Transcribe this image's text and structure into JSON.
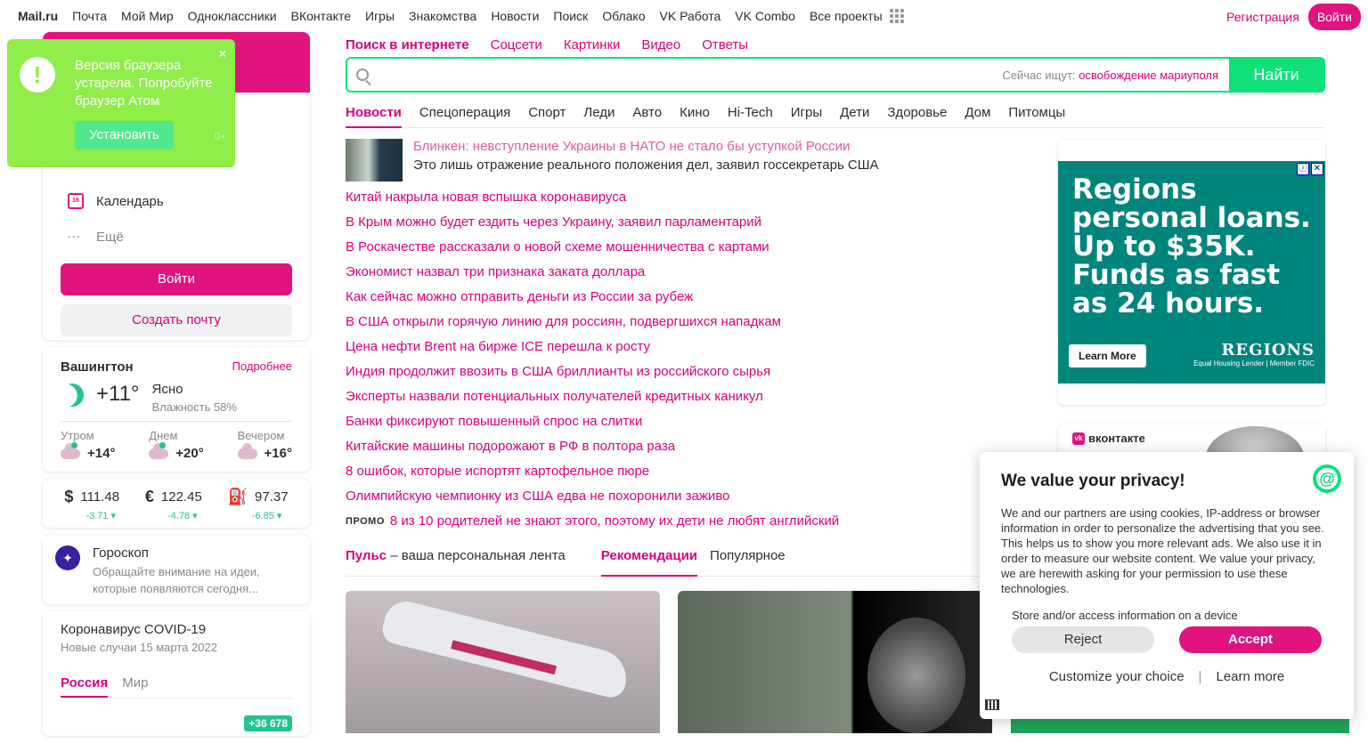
{
  "topbar": {
    "logo": "Mail.ru",
    "items": [
      "Почта",
      "Мой Мир",
      "Одноклассники",
      "ВКонтакте",
      "Игры",
      "Знакомства",
      "Новости",
      "Поиск",
      "Облако",
      "VK Работа",
      "VK Combo",
      "Все проекты"
    ],
    "register": "Регистрация",
    "login": "Войти"
  },
  "browser_popup": {
    "text": "Версия браузера устарела. Попробуйте браузер Атом",
    "button": "Установить",
    "close": "×",
    "counter": "0+"
  },
  "mail_card": {
    "calendar_label": "Календарь",
    "calendar_day": "16",
    "more_label": "Ещё",
    "login_button": "Войти",
    "create_button": "Создать почту"
  },
  "weather": {
    "city": "Вашингтон",
    "more": "Подробнее",
    "temp": "+11°",
    "desc": "Ясно",
    "humidity": "Влажность 58%",
    "parts": [
      {
        "label": "Утром",
        "temp": "+14°"
      },
      {
        "label": "Днем",
        "temp": "+20°"
      },
      {
        "label": "Вечером",
        "temp": "+16°"
      }
    ]
  },
  "rates": [
    {
      "symbol": "$",
      "value": "111.48",
      "change": "-3.71 ▾"
    },
    {
      "symbol": "€",
      "value": "122.45",
      "change": "-4.78 ▾"
    },
    {
      "symbol": "⛽",
      "value": "97.37",
      "change": "-6.85 ▾"
    }
  ],
  "horoscope": {
    "title": "Гороскоп",
    "text": "Обращайте внимание на идеи, которые появляются сегодня...",
    "icon": "✦"
  },
  "covid": {
    "title": "Коронавирус COVID-19",
    "subtitle": "Новые случаи 15 марта 2022",
    "tabs": [
      "Россия",
      "Мир"
    ],
    "badge": "+36 678"
  },
  "search": {
    "tabs": [
      "Поиск в интернете",
      "Соцсети",
      "Картинки",
      "Видео",
      "Ответы"
    ],
    "hint_label": "Сейчас ищут:",
    "hint_query": "освобождение мариуполя",
    "button": "Найти"
  },
  "news_tabs": [
    "Новости",
    "Спецоперация",
    "Спорт",
    "Леди",
    "Авто",
    "Кино",
    "Hi-Tech",
    "Игры",
    "Дети",
    "Здоровье",
    "Дом",
    "Питомцы"
  ],
  "news": {
    "lead_title": "Блинкен: невступление Украины в НАТО не стало бы уступкой России",
    "lead_sub": "Это лишь отражение реального положения дел, заявил госсекретарь США",
    "items": [
      "Китай накрыла новая вспышка коронавируса",
      "В Крым можно будет ездить через Украину, заявил парламентарий",
      "В Роскачестве рассказали о новой схеме мошенничества с картами",
      "Экономист назвал три признака заката доллара",
      "Как сейчас можно отправить деньги из России за рубеж",
      "В США открыли горячую линию для россиян, подвергшихся нападкам",
      "Цена нефти Brent на бирже ICE перешла к росту",
      "Индия продолжит ввозить в США бриллианты из российского сырья",
      "Эксперты назвали потенциальных получателей кредитных каникул",
      "Банки фиксируют повышенный спрос на слитки",
      "Китайские машины подорожают в РФ в полтора раза",
      "8 ошибок, которые испортят картофельное пюре",
      "Олимпийскую чемпионку из США едва не похоронили заживо"
    ],
    "promo_label": "ПРОМО",
    "promo_text": "8 из 10 родителей не знают этого, поэтому их дети не любят английский"
  },
  "pulse": {
    "brand": "Пульс",
    "tagline": "– ваша персональная лента",
    "tabs": [
      "Рекомендации",
      "Популярное"
    ]
  },
  "ad": {
    "headline": "Regions personal loans. Up to $35K. Funds as fast as 24 hours.",
    "button": "Learn More",
    "logo": "REGIONS",
    "logo_sub": "Equal Housing Lender | Member FDIC",
    "info": "ⓘ",
    "close": "✕"
  },
  "vk_card": {
    "logo": "вконтакте"
  },
  "privacy": {
    "title": "We value your privacy!",
    "text": "We and our partners are using cookies, IP-address or browser information in order to personalize the advertising that you see. This helps us to show you more relevant ads. We also use it in order to measure our website content. We value your privacy, we are herewith asking for your permission to use these technologies.",
    "sub": "Store and/or access information on a device",
    "reject": "Reject",
    "accept": "Accept",
    "customize": "Customize your choice",
    "separator": "|",
    "learn_more": "Learn more"
  }
}
